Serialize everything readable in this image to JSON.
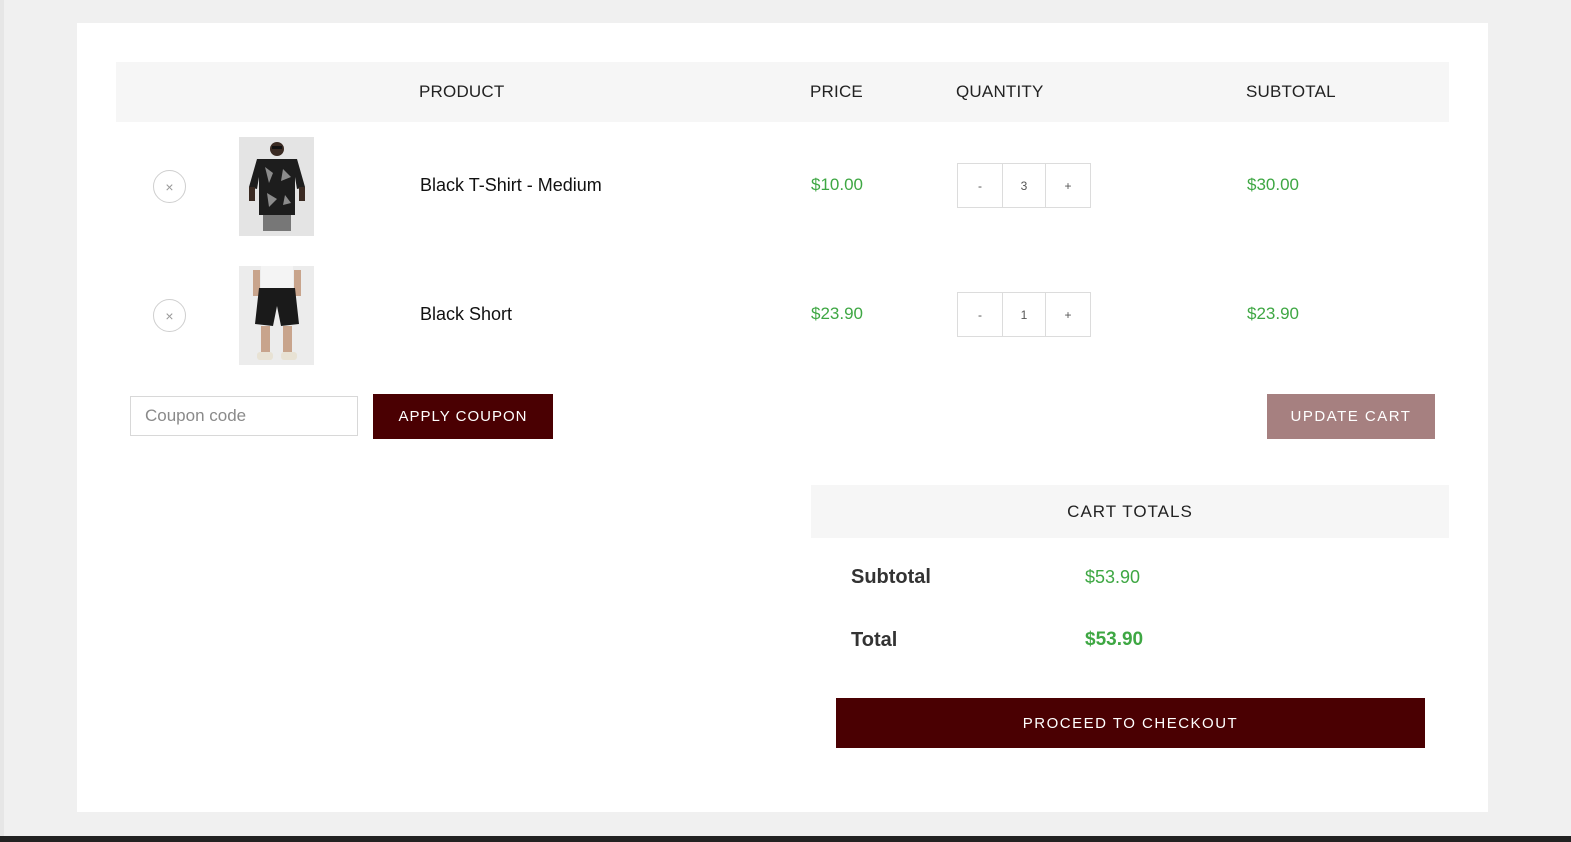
{
  "cart": {
    "headers": {
      "product": "PRODUCT",
      "price": "PRICE",
      "quantity": "QUANTITY",
      "subtotal": "SUBTOTAL"
    },
    "items": [
      {
        "name": "Black T-Shirt - Medium",
        "price": "$10.00",
        "qty_minus": "-",
        "qty": "3",
        "qty_plus": "+",
        "subtotal": "$30.00",
        "remove": "×"
      },
      {
        "name": "Black Short",
        "price": "$23.90",
        "qty_minus": "-",
        "qty": "1",
        "qty_plus": "+",
        "subtotal": "$23.90",
        "remove": "×"
      }
    ]
  },
  "coupon": {
    "placeholder": "Coupon code",
    "apply_label": "APPLY COUPON"
  },
  "update_label": "UPDATE CART",
  "totals": {
    "heading": "CART TOTALS",
    "subtotal_label": "Subtotal",
    "subtotal_value": "$53.90",
    "total_label": "Total",
    "total_value": "$53.90",
    "checkout_label": "PROCEED TO CHECKOUT"
  },
  "colors": {
    "accent": "#4a0002",
    "update_button": "#a68080",
    "price_green": "#3ea743",
    "header_bg": "#f6f6f6"
  }
}
